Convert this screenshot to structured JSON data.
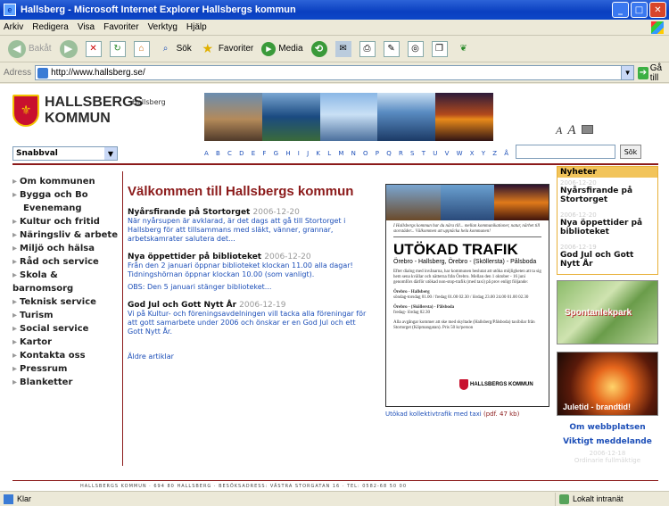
{
  "window": {
    "title": "Hallsberg - Microsoft Internet Explorer Hallsbergs kommun",
    "buttons": [
      "_",
      "□",
      "✕"
    ]
  },
  "menu": [
    "Arkiv",
    "Redigera",
    "Visa",
    "Favoriter",
    "Verktyg",
    "Hjälp"
  ],
  "toolbar": {
    "back": "Bakåt",
    "search": "Sök",
    "favorites": "Favoriter",
    "media": "Media"
  },
  "address": {
    "label": "Adress",
    "url": "http://www.hallsberg.se/",
    "go": "Gå till"
  },
  "site": {
    "logo_line1": "HALLSBERGS",
    "logo_line2": "KOMMUN",
    "crumb": "Hallsberg",
    "text_small": "A",
    "text_big": "A",
    "quickselect": "Snabbval",
    "alphabet": "A B C D E F G H I J K L M N O P Q R S T U V W X Y Z Å Ä Ö",
    "search_button": "Sök"
  },
  "leftnav": [
    {
      "label": "Om kommunen"
    },
    {
      "label": "Bygga och Bo"
    },
    {
      "label": "Evenemang",
      "sub": true
    },
    {
      "label": "Kultur och fritid"
    },
    {
      "label": "Näringsliv & arbete"
    },
    {
      "label": "Miljö och hälsa"
    },
    {
      "label": "Råd och service"
    },
    {
      "label": "Skola & barnomsorg"
    },
    {
      "label": "Teknisk service"
    },
    {
      "label": "Turism"
    },
    {
      "label": "Social service"
    },
    {
      "label": "Kartor"
    },
    {
      "label": "Kontakta oss"
    },
    {
      "label": "Pressrum"
    },
    {
      "label": "Blanketter"
    }
  ],
  "main": {
    "heading": "Välkommen till Hallsbergs kommun",
    "news": [
      {
        "title": "Nyårsfirande på Stortorget",
        "date": "2006-12-20",
        "text": "När nyårsupen är avklarad, är det dags att gå till Stortorget i Hallsberg för att tillsammans med släkt, vänner, grannar, arbetskamrater salutera det..."
      },
      {
        "title": "Nya öppettider på biblioteket",
        "date": "2006-12-20",
        "text": "Från den 2 januari öppnar biblioteket klockan 11.00 alla dagar! Tidningshörnan öppnar klockan 10.00 (som vanligt).",
        "text2": "OBS: Den 5 januari stänger biblioteket..."
      },
      {
        "title": "God Jul och Gott Nytt År",
        "date": "2006-12-19",
        "text": "Vi på Kultur- och föreningsavdelningen vill tacka alla föreningar för att gott samarbete under 2006 och önskar er en God Jul och ett Gott Nytt År."
      }
    ],
    "older": "Äldre artiklar"
  },
  "poster": {
    "intro": "I Hallsbergs kommun har du nära till... mellan kommunikationer, natur, närhet till storstäder... Välkommen att upptäcka hela kommunen!",
    "title": "UTÖKAD TRAFIK",
    "route": "Örebro - Hallsberg, Örebro - (Sköllersta) - Pålsboda",
    "body": "Efter dialog med invånarna, har kommunen beslutat att utöka möjligheten att ta sig hem sena kvällar och nätterna från Örebro. Mellan den 1 oktober - 16 juni genomförs därför utökad non-stop-trafik (med taxi) på prov enligt följande:",
    "sched1_head": "Örebro - Hallsberg",
    "sched1": "söndag-torsdag 01.00 / fredag 01.00 02.30 / lördag 23.00 24.00 01.00 02.30",
    "sched2_head": "Örebro - (Sköllersta) - Pålsboda",
    "sched2": "fredag- lördag 02.30",
    "footer": "Alla avgångar kommer att ske med skyltade (Hallsberg/Pålsboda) taxibilar från Stortorget (Köpmangatan). Pris 50 kr/person",
    "logo": "HALLSBERGS KOMMUN"
  },
  "pdf_link": {
    "text": "Utökad kollektivtrafik med taxi",
    "size": "(pdf. 47 kb)"
  },
  "right": {
    "news_header": "Nyheter",
    "news": [
      {
        "date": "2006-12-20",
        "title": "Nyårsfirande på Stortorget"
      },
      {
        "date": "2006-12-20",
        "title": "Nya öppettider på biblioteket"
      },
      {
        "date": "2006-12-19",
        "title": "God Jul och Gott Nytt År"
      }
    ],
    "map_caption": "Spontanlekpark",
    "fire_caption": "Juletid - brandtid!",
    "link1": "Om webbplatsen",
    "link2": "Viktigt meddelande",
    "faded_date": "2006-12-18",
    "faded_text": "Ordinarie fullmäktige"
  },
  "footer": "HALLSBERGS KOMMUN · 694 80 HALLSBERG · BESÖKSADRESS: VÄSTRA STORGATAN 16 · TEL: 0582-68 50 00",
  "status": {
    "text": "Klar",
    "zone": "Lokalt intranät"
  }
}
